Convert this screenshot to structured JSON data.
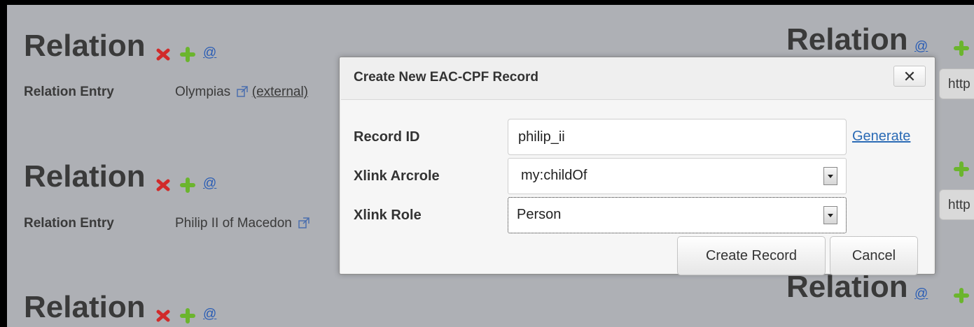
{
  "relations_left": [
    {
      "title": "Relation",
      "entry_label": "Relation Entry",
      "entry_value": "Olympias",
      "entry_suffix": "(external)",
      "at": "@"
    },
    {
      "title": "Relation",
      "entry_label": "Relation Entry",
      "entry_value": "Philip II of Macedon",
      "at": "@"
    },
    {
      "title": "Relation",
      "at": "@"
    }
  ],
  "relations_right": [
    {
      "title": "Relation",
      "at": "@",
      "http_value": "http"
    },
    {
      "http_value": "http"
    },
    {
      "title": "Relation",
      "at": "@"
    }
  ],
  "dialog": {
    "title": "Create New EAC-CPF Record",
    "close_label": "✕",
    "record_id_label": "Record ID",
    "record_id_value": "philip_ii",
    "generate_label": "Generate",
    "arcrole_label": "Xlink Arcrole",
    "arcrole_value": "my:childOf",
    "role_label": "Xlink Role",
    "role_value": "Person",
    "create_label": "Create Record",
    "cancel_label": "Cancel"
  },
  "colors": {
    "background": "#aeb0b5",
    "remove_icon": "#d12a2a",
    "add_icon": "#6bb52e",
    "link": "#2a5db5"
  },
  "icons": {
    "remove": "remove-x-icon",
    "add": "add-plus-icon",
    "external": "external-link-icon"
  }
}
